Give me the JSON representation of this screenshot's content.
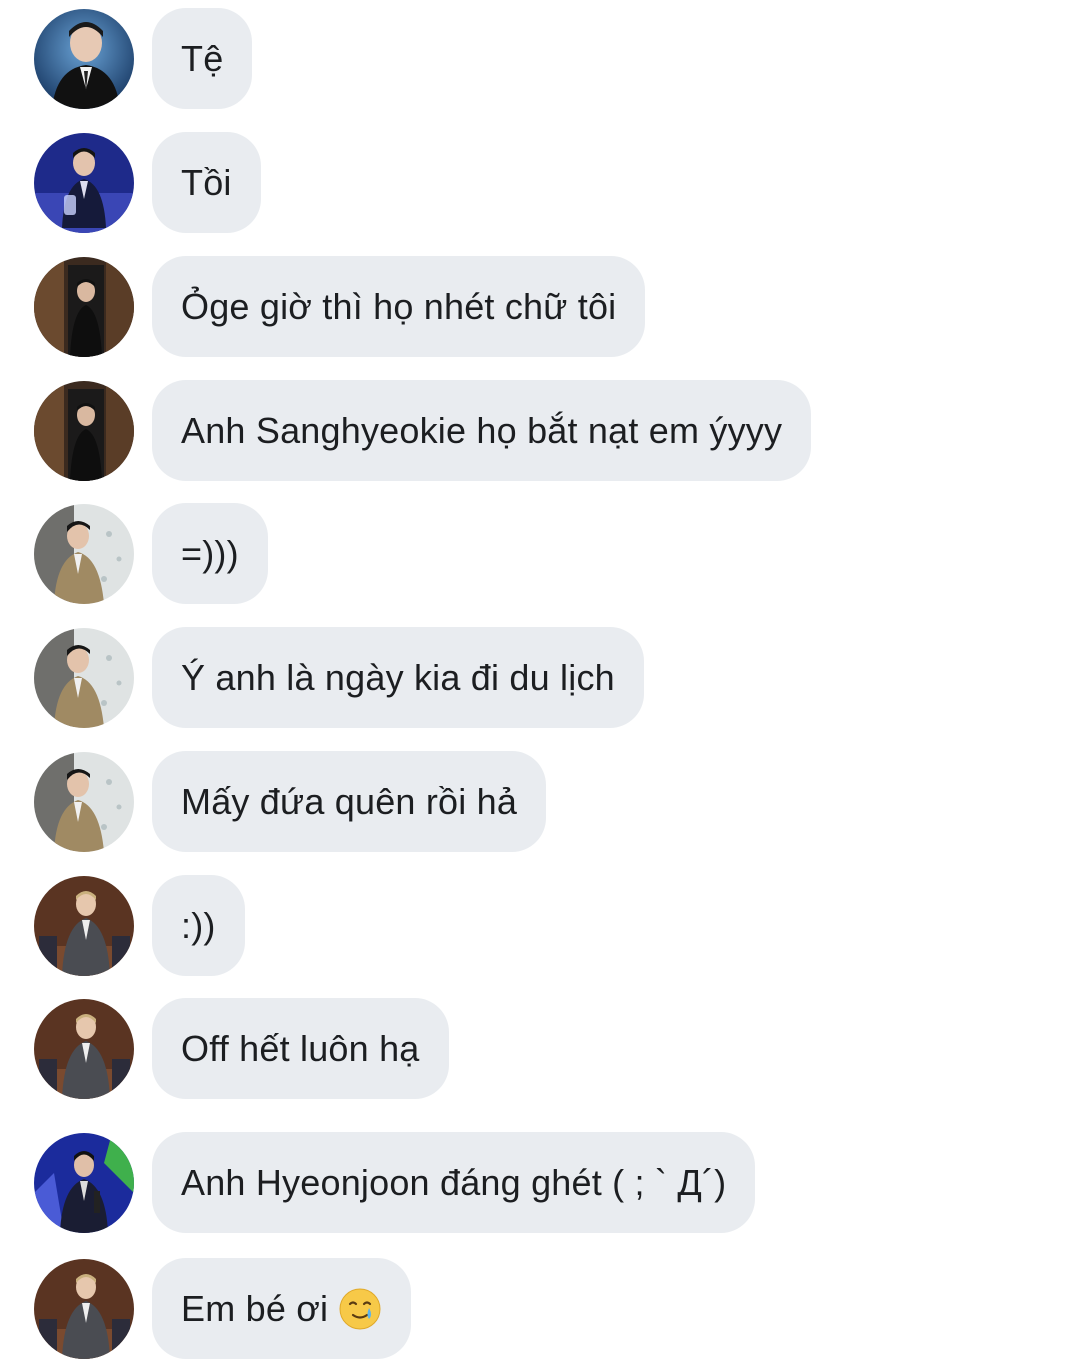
{
  "messages": [
    {
      "avatar": "avatar-dark-suit-blue-bg",
      "text": "Tệ"
    },
    {
      "avatar": "avatar-stage-blue-bg",
      "text": "Tồi"
    },
    {
      "avatar": "avatar-dark-doorway",
      "text": "Ỏge giờ thì họ nhét chữ tôi"
    },
    {
      "avatar": "avatar-dark-doorway",
      "text": "Anh Sanghyeokie họ bắt nạt em ýyyy"
    },
    {
      "avatar": "avatar-tweed-jacket",
      "text": "=)))"
    },
    {
      "avatar": "avatar-tweed-jacket",
      "text": "Ý anh là ngày kia đi du lịch"
    },
    {
      "avatar": "avatar-tweed-jacket",
      "text": "Mấy đứa quên rồi hả"
    },
    {
      "avatar": "avatar-grey-suit-chairs",
      "text": ":))"
    },
    {
      "avatar": "avatar-grey-suit-chairs",
      "text": "Off hết luôn hạ"
    },
    {
      "avatar": "avatar-stage-blue-green",
      "text": "Anh Hyeonjoon đáng ghét ( ; ` Д´)"
    },
    {
      "avatar": "avatar-grey-suit-chairs",
      "text": "Em bé ơi",
      "emoji": "crying-smile-emoji"
    }
  ],
  "colors": {
    "bubble": "#e9ecf0",
    "text": "#1c1e21",
    "background": "#ffffff"
  }
}
